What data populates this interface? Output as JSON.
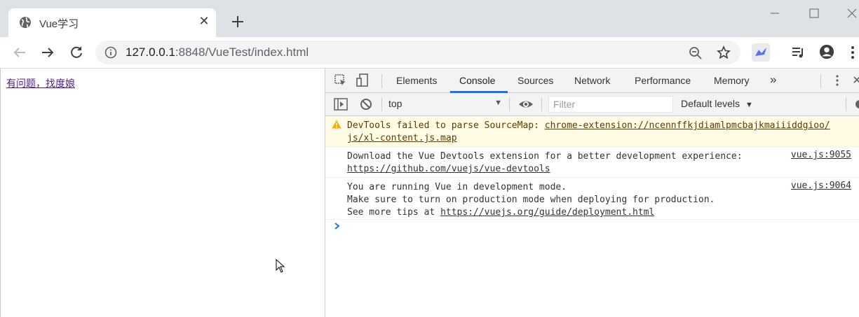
{
  "browser": {
    "tab": {
      "title": "Vue学习",
      "favicon": "globe-icon"
    },
    "url": {
      "host": "127.0.0.1",
      "rest": ":8848/VueTest/index.html"
    }
  },
  "page": {
    "link_text": "有问题，找度娘"
  },
  "devtools": {
    "tabs": [
      "Elements",
      "Console",
      "Sources",
      "Network",
      "Performance",
      "Memory"
    ],
    "active_tab": "Console",
    "more_tabs": "»",
    "context": "top",
    "filter_placeholder": "Filter",
    "levels": "Default levels",
    "messages": [
      {
        "type": "warning",
        "lines": [
          "DevTools failed to parse SourceMap: ",
          "js/xl-content.js.map"
        ],
        "link": "chrome-extension://ncennffkjdiamlpmcbajkmaiiiddgioo/"
      },
      {
        "type": "log",
        "lines": [
          "Download the Vue Devtools extension for a better development experience:"
        ],
        "link": "https://github.com/vuejs/vue-devtools",
        "source": "vue.js:9055"
      },
      {
        "type": "log",
        "lines": [
          "You are running Vue in development mode.",
          "Make sure to turn on production mode when deploying for production.",
          "See more tips at "
        ],
        "link": "https://vuejs.org/guide/deployment.html",
        "source": "vue.js:9064"
      }
    ]
  },
  "colors": {
    "accent": "#1a73e8",
    "titlebar": "#dee1e6",
    "warning_bg": "#fffbe5",
    "visited_link": "#551a8b"
  }
}
